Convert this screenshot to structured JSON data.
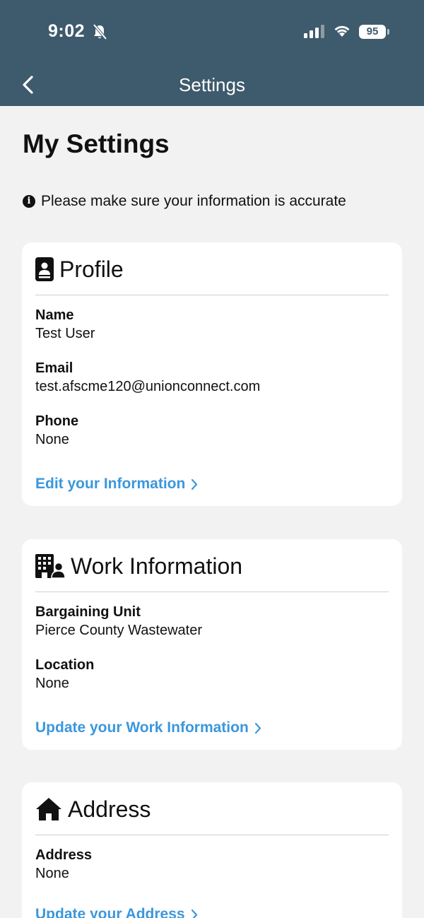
{
  "status_bar": {
    "time": "9:02",
    "battery": "95"
  },
  "nav": {
    "title": "Settings"
  },
  "page": {
    "title": "My Settings",
    "notice": "Please make sure your information is accurate"
  },
  "profile": {
    "title": "Profile",
    "fields": [
      {
        "label": "Name",
        "value": "Test User"
      },
      {
        "label": "Email",
        "value": "test.afscme120@unionconnect.com"
      },
      {
        "label": "Phone",
        "value": "None"
      }
    ],
    "link": "Edit your Information"
  },
  "work": {
    "title": "Work Information",
    "fields": [
      {
        "label": "Bargaining Unit",
        "value": "Pierce County Wastewater"
      },
      {
        "label": "Location",
        "value": "None"
      }
    ],
    "link": "Update your Work Information"
  },
  "address": {
    "title": "Address",
    "fields": [
      {
        "label": "Address",
        "value": "None"
      }
    ],
    "link": "Update your Address"
  },
  "colors": {
    "header": "#3e5a6d",
    "link": "#3b97dc",
    "background": "#f2f2f2"
  },
  "icons": [
    "bell-slash-icon",
    "signal-icon",
    "wifi-icon",
    "battery-icon",
    "chevron-left-icon",
    "info-icon",
    "contact-card-icon",
    "building-user-icon",
    "house-icon",
    "chevron-right-icon"
  ]
}
